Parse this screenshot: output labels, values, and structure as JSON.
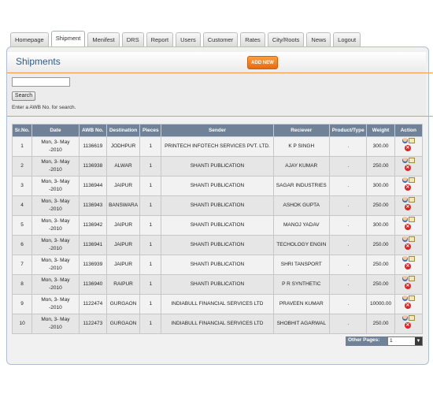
{
  "tabs": [
    "Homepage",
    "Shipment",
    "Menifest",
    "DRS",
    "Report",
    "Users",
    "Customer",
    "Rates",
    "City/Roots",
    "News",
    "Logout"
  ],
  "active_tab": "Shipment",
  "page": {
    "title": "Shipments",
    "add_button": "ADD NEW"
  },
  "search": {
    "value": "",
    "button": "Search",
    "hint": "Enter a AWB No. for search."
  },
  "table": {
    "headers": [
      "Sr.No.",
      "Date",
      "AWB No.",
      "Destination",
      "Pieces",
      "Sender",
      "Reciever",
      "Product/Type",
      "Weight",
      "Action"
    ],
    "rows": [
      {
        "sr": "1",
        "date": "Mon, 3- May -2010",
        "awb": "1136619",
        "dest": "JODHPUR",
        "pieces": "1",
        "sender": "PRINTECH INFOTECH SERVICES PVT. LTD.",
        "receiver": "K P SINGH",
        "product": ".",
        "weight": "300.00"
      },
      {
        "sr": "2",
        "date": "Mon, 3- May -2010",
        "awb": "1136938",
        "dest": "ALWAR",
        "pieces": "1",
        "sender": "SHANTI PUBLICATION",
        "receiver": "AJAY KUMAR",
        "product": ".",
        "weight": "250.00"
      },
      {
        "sr": "3",
        "date": "Mon, 3- May -2010",
        "awb": "1136944",
        "dest": "JAIPUR",
        "pieces": "1",
        "sender": "SHANTI PUBLICATION",
        "receiver": "SAGAR INDUSTRIES",
        "product": ".",
        "weight": "300.00"
      },
      {
        "sr": "4",
        "date": "Mon, 3- May -2010",
        "awb": "1136943",
        "dest": "BANSWARA",
        "pieces": "1",
        "sender": "SHANTI PUBLICATION",
        "receiver": "ASHOK GUPTA",
        "product": ".",
        "weight": "250.00"
      },
      {
        "sr": "5",
        "date": "Mon, 3- May -2010",
        "awb": "1136942",
        "dest": "JAIPUR",
        "pieces": "1",
        "sender": "SHANTI PUBLICATION",
        "receiver": "MANOJ YADAV",
        "product": ".",
        "weight": "300.00"
      },
      {
        "sr": "6",
        "date": "Mon, 3- May -2010",
        "awb": "1136941",
        "dest": "JAIPUR",
        "pieces": "1",
        "sender": "SHANTI PUBLICATION",
        "receiver": "TECHOLOGY ENGIN",
        "product": ".",
        "weight": "250.00"
      },
      {
        "sr": "7",
        "date": "Mon, 3- May -2010",
        "awb": "1136939",
        "dest": "JAIPUR",
        "pieces": "1",
        "sender": "SHANTI PUBLICATION",
        "receiver": "SHRI TANSPORT",
        "product": ".",
        "weight": "250.00"
      },
      {
        "sr": "8",
        "date": "Mon, 3- May -2010",
        "awb": "1136940",
        "dest": "RAIPUR",
        "pieces": "1",
        "sender": "SHANTI PUBLICATION",
        "receiver": "P R SYNTHETIC",
        "product": ".",
        "weight": "250.00"
      },
      {
        "sr": "9",
        "date": "Mon, 3- May -2010",
        "awb": "1122474",
        "dest": "GURGAON",
        "pieces": "1",
        "sender": "INDIABULL FINANCIAL SERVICES LTD",
        "receiver": "PRAVEEN KUMAR",
        "product": ".",
        "weight": "10000.00"
      },
      {
        "sr": "10",
        "date": "Mon, 3- May -2010",
        "awb": "1122473",
        "dest": "GURGAON",
        "pieces": "1",
        "sender": "INDIABULL FINANCIAL SERVICES LTD",
        "receiver": "SHOBHIT AGARWAL",
        "product": ".",
        "weight": "250.00"
      }
    ]
  },
  "pager": {
    "label": "Other Pages:",
    "value": "1"
  },
  "icons": {
    "edit": "user-icon",
    "mail": "mail-icon",
    "delete": "delete-icon"
  },
  "colors": {
    "accent": "#f29a41",
    "header_bg": "#6f8297",
    "title": "#2c5a88"
  }
}
